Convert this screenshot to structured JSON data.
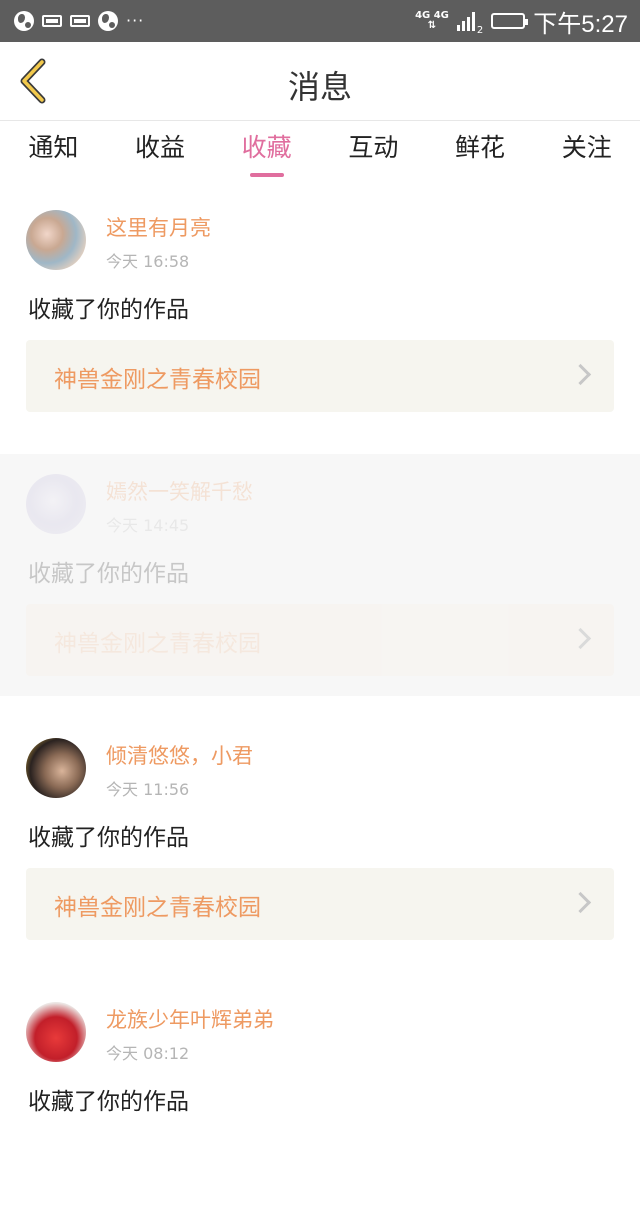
{
  "status_bar": {
    "time": "下午5:27",
    "network_top": "4G 4G",
    "network_bottom": "2",
    "overflow": "···"
  },
  "header": {
    "title": "消息"
  },
  "tabs": [
    {
      "label": "通知",
      "active": false
    },
    {
      "label": "收益",
      "active": false
    },
    {
      "label": "收藏",
      "active": true
    },
    {
      "label": "互动",
      "active": false
    },
    {
      "label": "鲜花",
      "active": false
    },
    {
      "label": "关注",
      "active": false
    }
  ],
  "messages": [
    {
      "user": "这里有月亮",
      "time": "今天 16:58",
      "action": "收藏了你的作品",
      "work": "神兽金刚之青春校园"
    },
    {
      "user": "嫣然一笑解千愁",
      "time": "今天 14:45",
      "action": "收藏了你的作品",
      "work": "神兽金刚之青春校园"
    },
    {
      "user": "倾清悠悠，小君",
      "time": "今天 11:56",
      "action": "收藏了你的作品",
      "work": "神兽金刚之青春校园"
    },
    {
      "user": "龙族少年叶辉弟弟",
      "time": "今天 08:12",
      "action": "收藏了你的作品",
      "work": ""
    }
  ],
  "colors": {
    "accent_pink": "#e06e9e",
    "name_orange": "#ee9a62",
    "statusbar": "#5d5d5d"
  }
}
